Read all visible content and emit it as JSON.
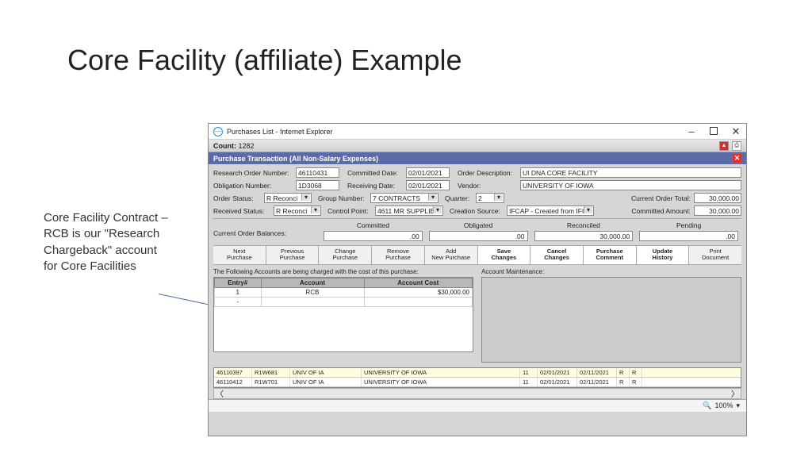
{
  "slide": {
    "title": "Core Facility (affiliate) Example",
    "note": "Core Facility Contract – RCB is our \"Research Chargeback\" account for Core Facilities"
  },
  "window": {
    "title": "Purchases List - Internet Explorer",
    "count_label": "Count:",
    "count_value": "1282",
    "zoom": "100%"
  },
  "panel_title": "Purchase Transaction (All Non-Salary Expenses)",
  "form": {
    "research_order_number_lbl": "Research Order Number:",
    "research_order_number": "46110431",
    "committed_date_lbl": "Committed Date:",
    "committed_date": "02/01/2021",
    "order_description_lbl": "Order Description:",
    "order_description": "UI DNA CORE FACILITY",
    "obligation_number_lbl": "Obligation Number:",
    "obligation_number": "1D3068",
    "receiving_date_lbl": "Receiving Date:",
    "receiving_date": "02/01/2021",
    "vendor_lbl": "Vendor:",
    "vendor": "UNIVERSITY OF IOWA",
    "order_status_lbl": "Order Status:",
    "order_status": "R Reconci",
    "group_number_lbl": "Group Number:",
    "group_number": "7 CONTRACTS",
    "quarter_lbl": "Quarter:",
    "quarter": "2",
    "current_order_total_lbl": "Current Order Total:",
    "current_order_total": "30,000.00",
    "received_status_lbl": "Received Status:",
    "received_status": "R Reconci",
    "control_point_lbl": "Control Point:",
    "control_point": "4611 MR SUPPLIE!",
    "creation_source_lbl": "Creation Source:",
    "creation_source": "IFCAP - Created from IFC/",
    "committed_amount_lbl": "Committed Amount:",
    "committed_amount": "30,000.00"
  },
  "balances": {
    "label": "Current Order Balances:",
    "cols": [
      "Committed",
      "Obligated",
      "Reconciled",
      "Pending"
    ],
    "vals": [
      ".00",
      ".00",
      "30,000.00",
      ".00"
    ]
  },
  "buttons": [
    "Next Purchase",
    "Previous Purchase",
    "Change Purchase",
    "Remove Purchase",
    "Add New Purchase",
    "Save Changes",
    "Cancel Changes",
    "Purchase Comment",
    "Update History",
    "Print Document"
  ],
  "buttons_bold": [
    false,
    false,
    false,
    false,
    false,
    true,
    true,
    true,
    true,
    false
  ],
  "charge": {
    "caption": "The Following Accounts are being charged with the cost of this purchase:",
    "maint_caption": "Account Maintenance:",
    "headers": [
      "Entry#",
      "Account",
      "Account Cost"
    ],
    "rows": [
      {
        "entry": "1",
        "account": "RCB",
        "cost": "$30,000.00"
      },
      {
        "entry": "-",
        "account": "",
        "cost": ""
      }
    ]
  },
  "grid": {
    "rows": [
      {
        "c1": "46110397",
        "c2": "R1W681",
        "c3": "UNIV OF IA",
        "c4": "UNIVERSITY OF IOWA",
        "c5": "11",
        "c6": "02/01/2021",
        "c7": "02/11/2021",
        "c8": "R",
        "c9": "R",
        "hl": true
      },
      {
        "c1": "46110412",
        "c2": "R1W701",
        "c3": "UNIV OF IA",
        "c4": "UNIVERSITY OF IOWA",
        "c5": "11",
        "c6": "02/01/2021",
        "c7": "02/11/2021",
        "c8": "R",
        "c9": "R",
        "hl": false
      }
    ]
  }
}
